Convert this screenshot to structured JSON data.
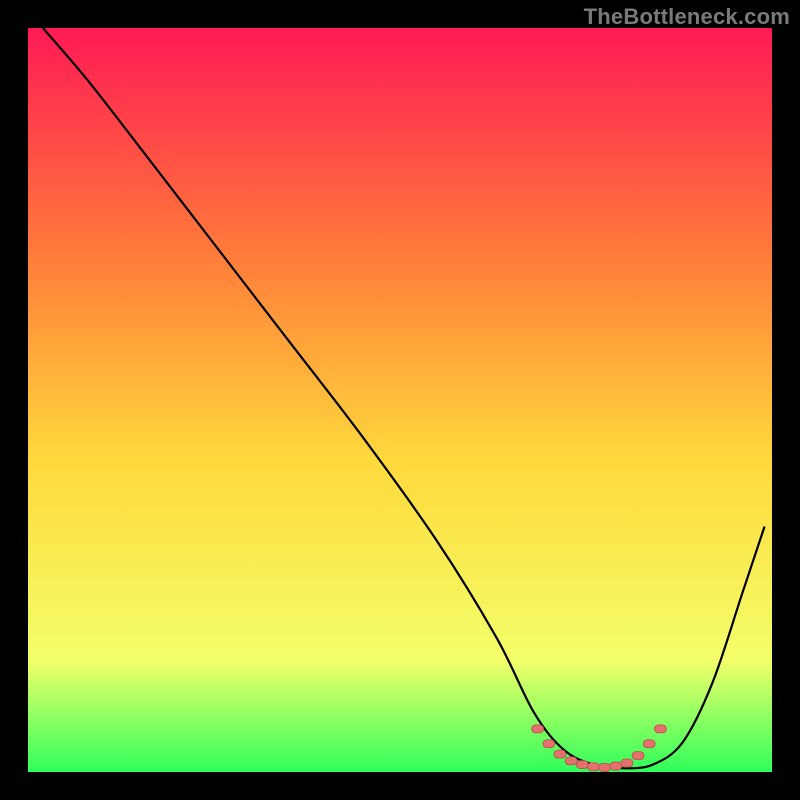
{
  "watermark": "TheBottleneck.com",
  "colors": {
    "page_bg": "#000000",
    "gradient_top": "#ff1a55",
    "gradient_upper_mid": "#ff7a3a",
    "gradient_mid": "#ffd93b",
    "gradient_lower_mid": "#f3ff6a",
    "gradient_bottom": "#2eff5a",
    "curve_stroke": "#000000",
    "marker_fill": "#e4716e",
    "marker_stroke": "#b84d4a"
  },
  "chart_data": {
    "type": "line",
    "title": "",
    "xlabel": "",
    "ylabel": "",
    "xlim": [
      0,
      100
    ],
    "ylim": [
      0,
      100
    ],
    "grid": false,
    "legend": false,
    "series": [
      {
        "name": "bottleneck-curve",
        "x": [
          2,
          8,
          15,
          25,
          35,
          45,
          55,
          63,
          68,
          72,
          76,
          80,
          84,
          88,
          92,
          96,
          99
        ],
        "y": [
          100,
          93,
          84,
          71,
          58,
          45,
          31,
          18,
          8,
          3,
          1,
          0.5,
          1,
          4,
          12,
          24,
          33
        ]
      }
    ],
    "markers": {
      "name": "optimal-range",
      "x": [
        68.5,
        70,
        71.5,
        73,
        74.5,
        76,
        77.5,
        79,
        80.5,
        82,
        83.5,
        85
      ],
      "y": [
        5.8,
        3.8,
        2.4,
        1.5,
        1.0,
        0.7,
        0.6,
        0.8,
        1.2,
        2.2,
        3.8,
        5.8
      ]
    }
  }
}
